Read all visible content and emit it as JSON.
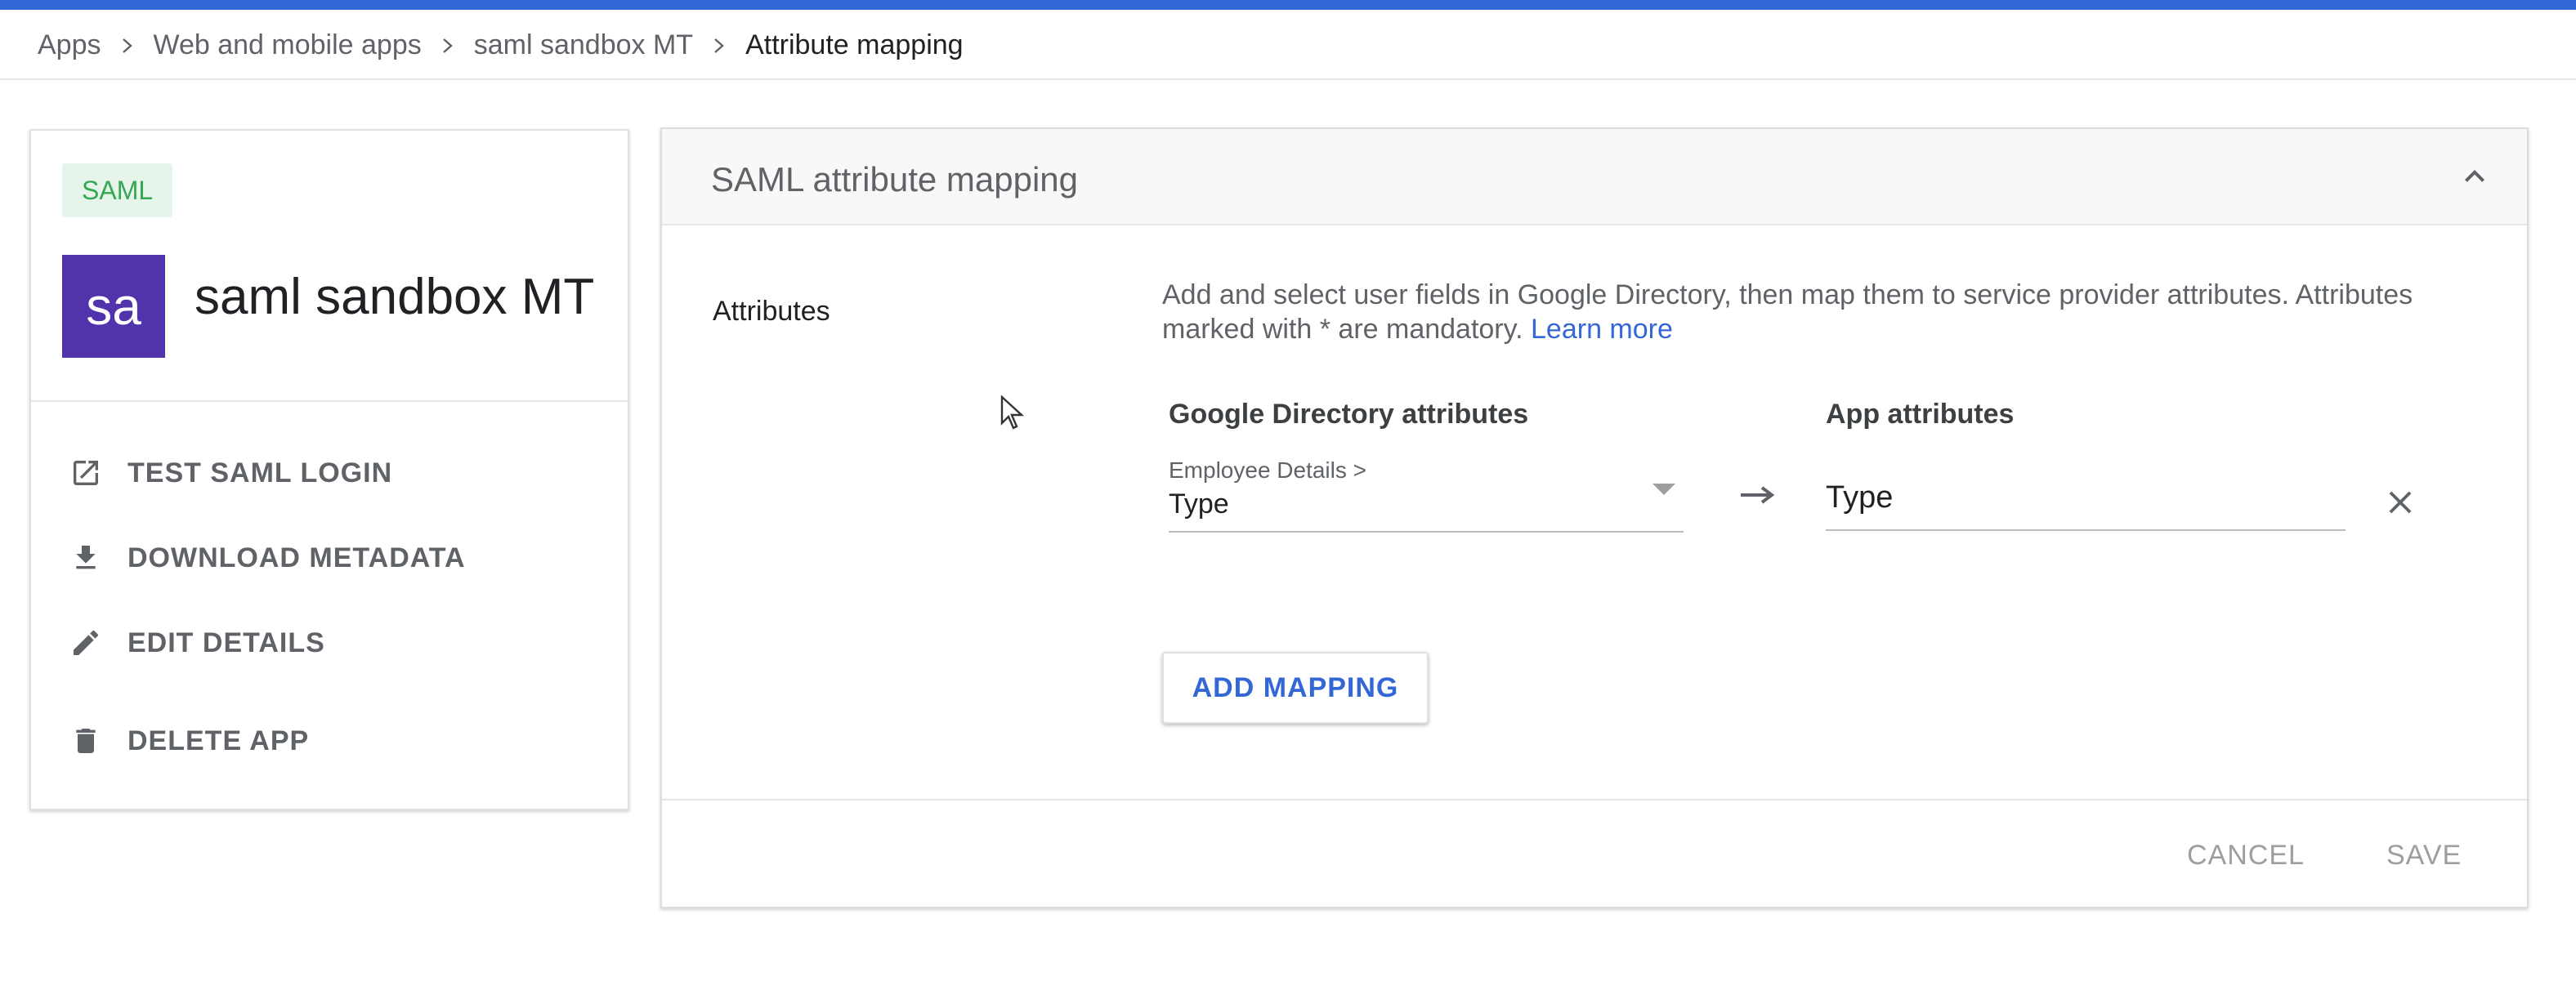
{
  "breadcrumb": {
    "items": [
      "Apps",
      "Web and mobile apps",
      "saml sandbox MT"
    ],
    "current": "Attribute mapping"
  },
  "app": {
    "badge": "SAML",
    "avatar_text": "sa",
    "avatar_color": "#5133ab",
    "name": "saml sandbox MT"
  },
  "actions": [
    {
      "label": "TEST SAML LOGIN",
      "icon": "open-in-new-icon"
    },
    {
      "label": "DOWNLOAD METADATA",
      "icon": "download-icon"
    },
    {
      "label": "EDIT DETAILS",
      "icon": "pencil-icon"
    },
    {
      "label": "DELETE APP",
      "icon": "trash-icon"
    }
  ],
  "panel": {
    "title": "SAML attribute mapping",
    "attributes_label": "Attributes",
    "description": "Add and select user fields in Google Directory, then map them to service provider attributes. Attributes marked with * are mandatory.",
    "learn_more": "Learn more",
    "col_directory": "Google Directory attributes",
    "col_app": "App attributes",
    "mapping": {
      "directory_category": "Employee Details >",
      "directory_value": "Type",
      "app_value": "Type"
    },
    "add_mapping": "ADD MAPPING",
    "cancel": "CANCEL",
    "save": "SAVE"
  },
  "colors": {
    "accent": "#3367d6",
    "badge_bg": "#e6f4ea",
    "badge_text": "#34a853"
  }
}
